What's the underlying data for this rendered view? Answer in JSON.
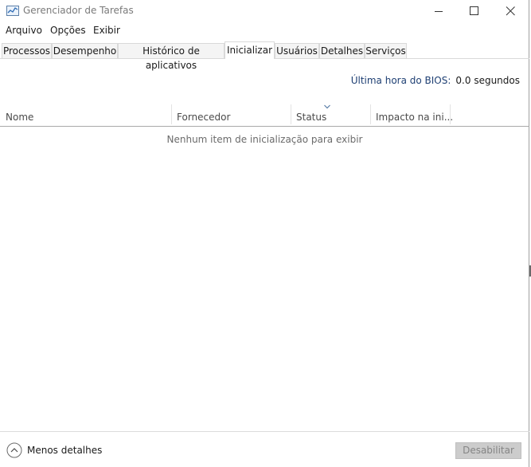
{
  "window": {
    "title": "Gerenciador de Tarefas"
  },
  "menu": {
    "items": [
      "Arquivo",
      "Opções",
      "Exibir"
    ]
  },
  "tabs": [
    {
      "label": "Processos",
      "active": false
    },
    {
      "label": "Desempenho",
      "active": false
    },
    {
      "label": "Histórico de aplicativos",
      "active": false
    },
    {
      "label": "Inicializar",
      "active": true
    },
    {
      "label": "Usuários",
      "active": false
    },
    {
      "label": "Detalhes",
      "active": false
    },
    {
      "label": "Serviços",
      "active": false
    }
  ],
  "bios": {
    "label": "Última hora do BIOS:",
    "value": "0.0 segundos"
  },
  "table": {
    "columns": [
      "Nome",
      "Fornecedor",
      "Status",
      "Impacto na ini..."
    ],
    "empty_message": "Nenhum item de inicialização para exibir",
    "rows": []
  },
  "footer": {
    "less_details_label": "Menos detalhes",
    "disable_label": "Desabilitar"
  },
  "colors": {
    "bios_label": "#1e3f73",
    "disabled_button_bg": "#cccccc",
    "tab_border": "#d9d9d9"
  },
  "icons": {
    "app": "task-manager-icon",
    "collapse": "chevron-up-circle-icon",
    "sort": "sort-down-icon"
  }
}
